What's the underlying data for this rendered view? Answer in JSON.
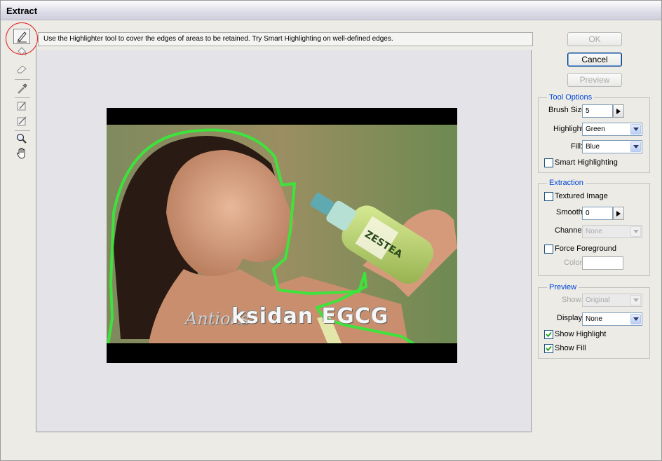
{
  "window": {
    "title": "Extract"
  },
  "hint": "Use the Highlighter tool to cover the edges of areas to be retained. Try Smart Highlighting on well-defined edges.",
  "tools": [
    "highlighter-tool",
    "fill-tool",
    "eraser-tool",
    "eyedropper-tool",
    "cleanup-tool",
    "edge-touchup-tool",
    "zoom-tool",
    "hand-tool"
  ],
  "image": {
    "overlay_prefix": "Antioks",
    "overlay_text": "ksidan EGCG",
    "bottle_label": "ZESTEA"
  },
  "buttons": {
    "ok": "OK",
    "cancel": "Cancel",
    "preview": "Preview"
  },
  "tool_options": {
    "legend": "Tool Options",
    "brush_size_label": "Brush Size:",
    "brush_size": "5",
    "highlight_label": "Highlight:",
    "highlight": "Green",
    "fill_label": "Fill:",
    "fill": "Blue",
    "smart_highlighting_label": "Smart Highlighting",
    "smart_highlighting": false
  },
  "extraction": {
    "legend": "Extraction",
    "textured_image_label": "Textured Image",
    "textured_image": false,
    "smooth_label": "Smooth:",
    "smooth": "0",
    "channel_label": "Channel:",
    "channel": "None",
    "force_foreground_label": "Force Foreground",
    "force_foreground": false,
    "color_label": "Color:"
  },
  "preview": {
    "legend": "Preview",
    "show_label": "Show:",
    "show": "Original",
    "display_label": "Display:",
    "display": "None",
    "show_highlight_label": "Show Highlight",
    "show_highlight": true,
    "show_fill_label": "Show Fill",
    "show_fill": true
  },
  "colors": {
    "highlight_green": "#39e83a",
    "legend_blue": "#0046d5",
    "focus_ring": "#e02020"
  }
}
